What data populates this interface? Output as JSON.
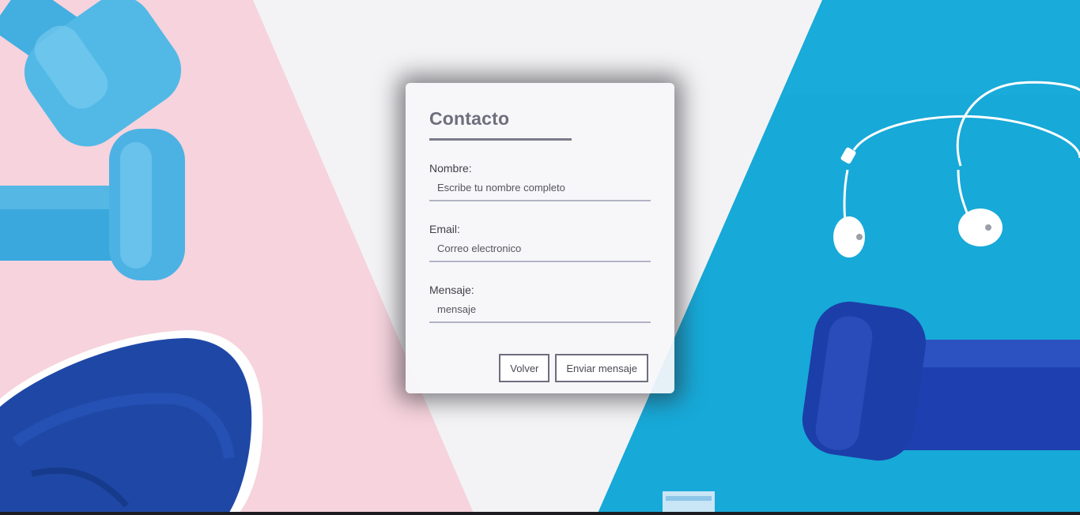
{
  "form": {
    "title": "Contacto",
    "fields": [
      {
        "label": "Nombre:",
        "placeholder": "Escribe tu nombre completo",
        "value": ""
      },
      {
        "label": "Email:",
        "placeholder": "Correo electronico",
        "value": ""
      },
      {
        "label": "Mensaje:",
        "placeholder": "mensaje",
        "value": ""
      }
    ],
    "buttons": {
      "back": "Volver",
      "send": "Enviar mensaje"
    }
  },
  "background": {
    "colors": {
      "pink": "#f6d3dd",
      "white": "#f3f3f5",
      "blue": "#1aa8d6",
      "dumbbell_light": "#4cb3e2",
      "dumbbell_dark": "#1a3fa8",
      "sneaker": "#1f48a6"
    },
    "objects": [
      "dumbbell-light-blue",
      "dumbbell-light-blue",
      "sneaker",
      "earphones",
      "dumbbell-dark-blue"
    ]
  }
}
